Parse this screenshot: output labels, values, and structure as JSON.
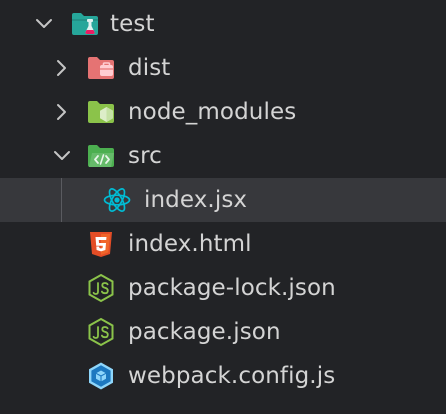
{
  "explorer": {
    "items": [
      {
        "label": "test",
        "icon": "folder-test-icon",
        "expanded": true
      },
      {
        "label": "dist",
        "icon": "folder-dist-icon",
        "expanded": false
      },
      {
        "label": "node_modules",
        "icon": "folder-node-icon",
        "expanded": false
      },
      {
        "label": "src",
        "icon": "folder-src-icon",
        "expanded": true
      },
      {
        "label": "index.jsx",
        "icon": "react-icon",
        "selected": true
      },
      {
        "label": "index.html",
        "icon": "html5-icon"
      },
      {
        "label": "package-lock.json",
        "icon": "nodejs-icon"
      },
      {
        "label": "package.json",
        "icon": "nodejs-icon"
      },
      {
        "label": "webpack.config.js",
        "icon": "webpack-icon"
      }
    ]
  },
  "colors": {
    "background": "#222326",
    "selected_row": "#37383c",
    "text": "#d4d4d4",
    "folder_test": "#26a69a",
    "folder_dist": "#e57373",
    "folder_node": "#8bc34a",
    "folder_src": "#4caf50",
    "react": "#00bcd4",
    "html5": "#e44d26",
    "nodejs": "#8bc34a",
    "webpack": "#42a5f5"
  }
}
